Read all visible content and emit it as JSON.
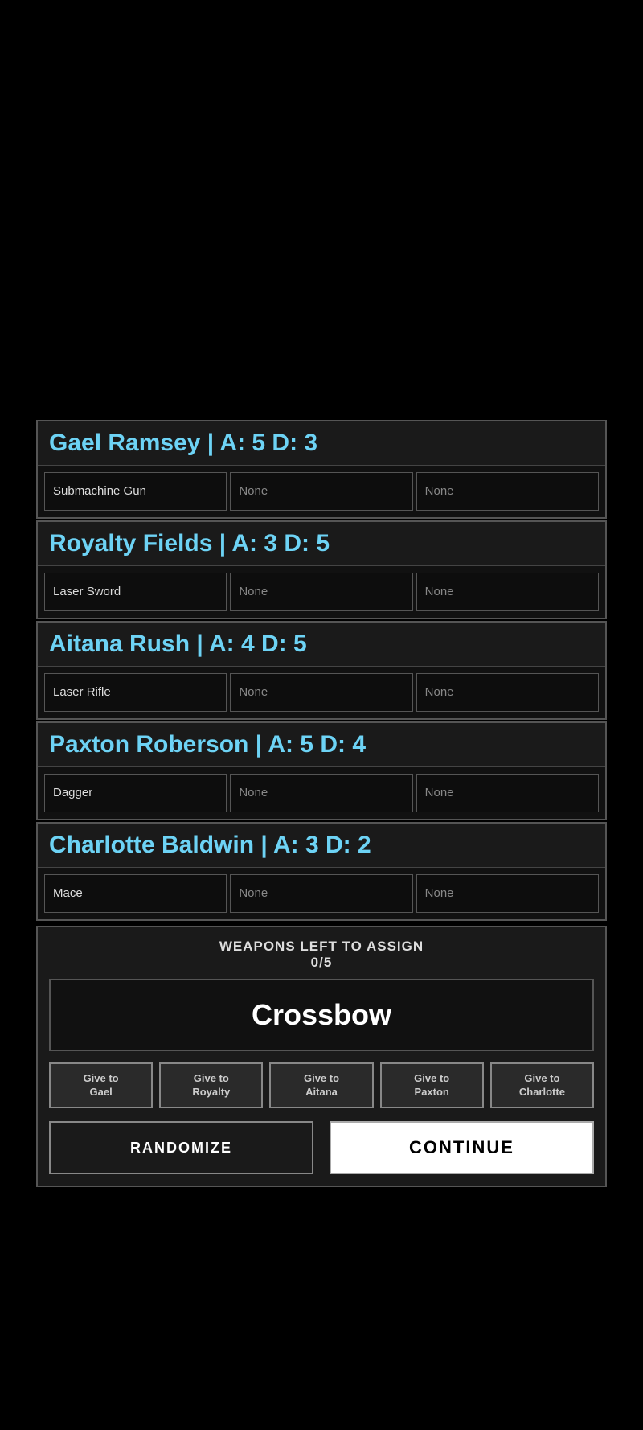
{
  "characters": [
    {
      "name": "Gael Ramsey",
      "attack": 5,
      "defense": 3,
      "header_label": "Gael Ramsey | A: 5 D: 3",
      "slots": [
        "Submachine Gun",
        "None",
        "None"
      ]
    },
    {
      "name": "Royalty Fields",
      "attack": 3,
      "defense": 5,
      "header_label": "Royalty Fields | A: 3 D: 5",
      "slots": [
        "Laser Sword",
        "None",
        "None"
      ]
    },
    {
      "name": "Aitana Rush",
      "attack": 4,
      "defense": 5,
      "header_label": "Aitana Rush | A: 4 D: 5",
      "slots": [
        "Laser Rifle",
        "None",
        "None"
      ]
    },
    {
      "name": "Paxton Roberson",
      "attack": 5,
      "defense": 4,
      "header_label": "Paxton Roberson | A: 5 D: 4",
      "slots": [
        "Dagger",
        "None",
        "None"
      ]
    },
    {
      "name": "Charlotte Baldwin",
      "attack": 3,
      "defense": 2,
      "header_label": "Charlotte Baldwin | A: 3 D: 2",
      "slots": [
        "Mace",
        "None",
        "None"
      ]
    }
  ],
  "weapons_counter_label": "WEAPONS LEFT TO ASSIGN",
  "weapons_count": "0/5",
  "current_weapon": "Crossbow",
  "give_buttons": [
    {
      "label": "Give to\nGael",
      "name": "give-to-gael"
    },
    {
      "label": "Give to\nRoyalty",
      "name": "give-to-royalty"
    },
    {
      "label": "Give to\nAitana",
      "name": "give-to-aitana"
    },
    {
      "label": "Give to\nPaxton",
      "name": "give-to-paxton"
    },
    {
      "label": "Give to\nCharlotte",
      "name": "give-to-charlotte"
    }
  ],
  "randomize_label": "RANDOMIZE",
  "continue_label": "CONTINUE"
}
